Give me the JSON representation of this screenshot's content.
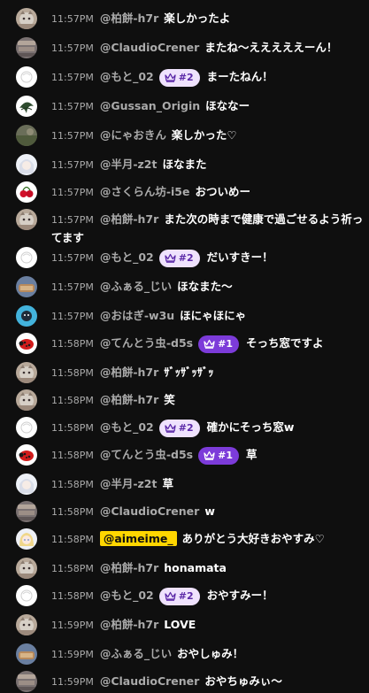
{
  "colors": {
    "background": "#0f0f0f",
    "timestamp": "#aaaaaa",
    "author": "#aaaaaa",
    "message": "#ffffff",
    "badge_rank2_bg": "#efe2fd",
    "badge_rank1_bg": "#7c3bd9",
    "highlight_author_bg": "#ffd600"
  },
  "messages": [
    {
      "time": "11:57PM",
      "author": "@柏餅-h7r",
      "text": "楽しかったよ",
      "avatar": "cat"
    },
    {
      "time": "11:57PM",
      "author": "@ClaudioCrener",
      "text": "またね〜えええええーん！",
      "avatar": "photo"
    },
    {
      "time": "11:57PM",
      "author": "@もと_02",
      "badge": "#2",
      "text": "まーたねん！",
      "avatar": "sketch"
    },
    {
      "time": "11:57PM",
      "author": "@Gussan_Origin",
      "text": "ほななー",
      "avatar": "leaf"
    },
    {
      "time": "11:57PM",
      "author": "@にゃおきん",
      "text": "楽しかった♡",
      "avatar": "field"
    },
    {
      "time": "11:57PM",
      "author": "@半月-z2t",
      "text": "ほなまた",
      "avatar": "anime"
    },
    {
      "time": "11:57PM",
      "author": "@さくらん坊-i5e",
      "text": "おついめー",
      "avatar": "cherry"
    },
    {
      "time": "11:57PM",
      "author": "@柏餅-h7r",
      "text": "また次の時まで健康で過ごせるよう祈ってます",
      "avatar": "cat"
    },
    {
      "time": "11:57PM",
      "author": "@もと_02",
      "badge": "#2",
      "text": "だいすきー！",
      "avatar": "sketch"
    },
    {
      "time": "11:57PM",
      "author": "@ふぁる_じい",
      "text": "ほなまた〜",
      "avatar": "food"
    },
    {
      "time": "11:57PM",
      "author": "@おはぎ-w3u",
      "text": "ほにゃほにゃ",
      "avatar": "blue"
    },
    {
      "time": "11:58PM",
      "author": "@てんとう虫-d5s",
      "badge": "#1",
      "text": "そっち窓ですよ",
      "avatar": "ladybug"
    },
    {
      "time": "11:58PM",
      "author": "@柏餅-h7r",
      "text": "ｻﾞｯｻﾞｯｻﾞｯ",
      "avatar": "cat"
    },
    {
      "time": "11:58PM",
      "author": "@柏餅-h7r",
      "text": "笑",
      "avatar": "cat"
    },
    {
      "time": "11:58PM",
      "author": "@もと_02",
      "badge": "#2",
      "text": "確かにそっち窓w",
      "avatar": "sketch"
    },
    {
      "time": "11:58PM",
      "author": "@てんとう虫-d5s",
      "badge": "#1",
      "text": "草",
      "avatar": "ladybug"
    },
    {
      "time": "11:58PM",
      "author": "@半月-z2t",
      "text": "草",
      "avatar": "anime"
    },
    {
      "time": "11:58PM",
      "author": "@ClaudioCrener",
      "text": "w",
      "avatar": "photo"
    },
    {
      "time": "11:58PM",
      "author": "@aimeime_",
      "highlight": true,
      "text": "ありがとう大好きおやすみ♡",
      "avatar": "girl"
    },
    {
      "time": "11:58PM",
      "author": "@柏餅-h7r",
      "text": "honamata",
      "avatar": "cat"
    },
    {
      "time": "11:58PM",
      "author": "@もと_02",
      "badge": "#2",
      "text": "おやすみー！",
      "avatar": "sketch"
    },
    {
      "time": "11:59PM",
      "author": "@柏餅-h7r",
      "text": "LOVE",
      "avatar": "cat"
    },
    {
      "time": "11:59PM",
      "author": "@ふぁる_じい",
      "text": "おやしゅみ！",
      "avatar": "food"
    },
    {
      "time": "11:59PM",
      "author": "@ClaudioCrener",
      "text": "おやちゅみぃ〜",
      "avatar": "photo"
    }
  ]
}
